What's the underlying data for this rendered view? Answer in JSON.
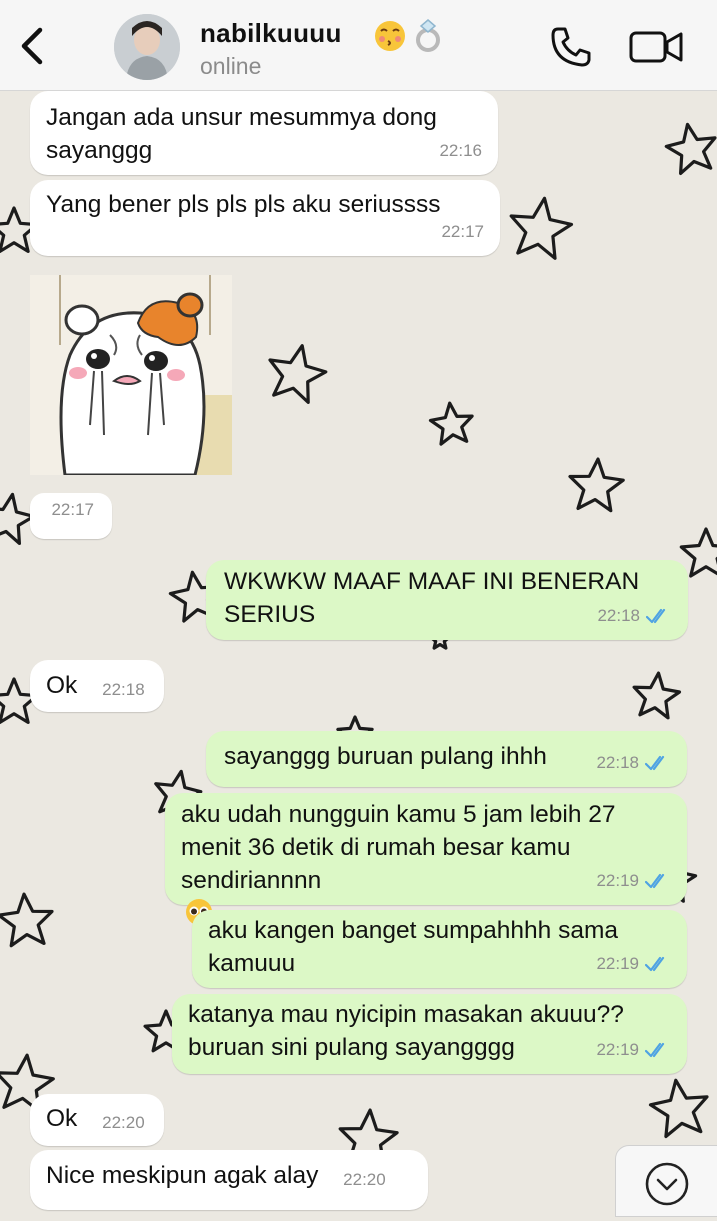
{
  "header": {
    "contact_name": "nabilkuuuu",
    "emoji_icons": [
      "kissing-face-icon",
      "ring-icon"
    ],
    "status": "online"
  },
  "messages": [
    {
      "direction": "in",
      "text": "Jangan ada unsur mesummya dong\nsayanggg",
      "time": "22:16"
    },
    {
      "direction": "in",
      "text": "Yang bener pls pls pls aku seriussss",
      "time": "22:17"
    },
    {
      "direction": "in",
      "type": "sticker",
      "sticker_icon": "crying-hamster-sticker",
      "time": "22:17"
    },
    {
      "direction": "out",
      "text": "WKWKW MAAF MAAF INI BENERAN\nSERIUS",
      "time": "22:18",
      "status": "read"
    },
    {
      "direction": "in",
      "text": "Ok",
      "time": "22:18"
    },
    {
      "direction": "out",
      "text": "sayanggg buruan pulang ihhh",
      "time": "22:18",
      "status": "read"
    },
    {
      "direction": "out",
      "text": "aku udah nungguin kamu 5 jam lebih 27\nmenit 36 detik di rumah besar kamu\nsendiriannnn",
      "emoji_icon": "pleading-face-icon",
      "time": "22:19",
      "status": "read"
    },
    {
      "direction": "out",
      "text": "aku kangen banget sumpahhhh sama\nkamuuu",
      "time": "22:19",
      "status": "read"
    },
    {
      "direction": "out",
      "text": "katanya mau nyicipin masakan akuuu??\nburuan sini pulang sayangggg",
      "time": "22:19",
      "status": "read"
    },
    {
      "direction": "in",
      "text": "Ok",
      "time": "22:20"
    },
    {
      "direction": "in",
      "text": "Nice meskipun agak alay",
      "time": "22:20"
    }
  ],
  "colors": {
    "chat_background": "#ebe8e1",
    "incoming_bubble": "#ffffff",
    "outgoing_bubble": "#dcf8c6",
    "read_ticks": "#4fa3e3"
  }
}
